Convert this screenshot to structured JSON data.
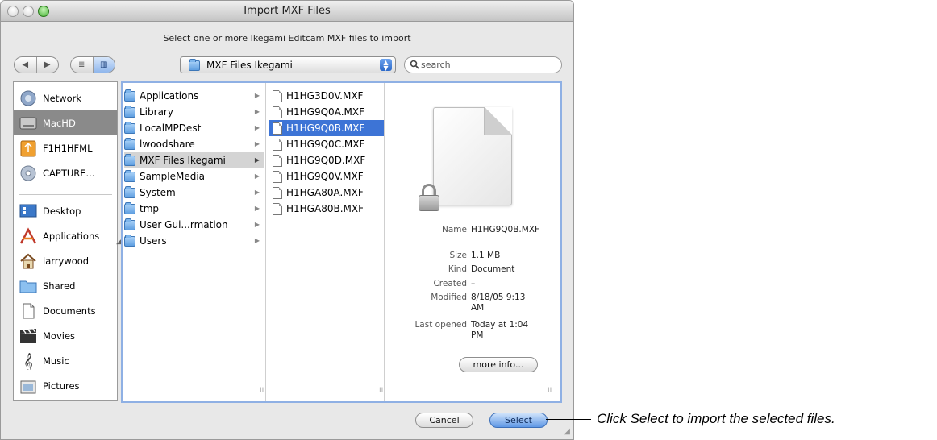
{
  "window": {
    "title": "Import MXF Files",
    "subtitle": "Select one or more Ikegami Editcam MXF files to import"
  },
  "toolbar": {
    "back_icon": "◀",
    "forward_icon": "▶",
    "list_view_icon": "≣",
    "column_view_icon": "▥",
    "location": "MXF Files Ikegami",
    "search_placeholder": "search"
  },
  "sidebar": {
    "items": [
      {
        "label": "Network",
        "icon": "network-icon"
      },
      {
        "label": "MacHD",
        "icon": "hard-disk-icon",
        "selected": true
      },
      {
        "label": "F1H1HFML",
        "icon": "removable-disk-icon"
      },
      {
        "label": "CAPTURE...",
        "icon": "disc-icon"
      },
      {
        "label": "Desktop",
        "icon": "desktop-icon"
      },
      {
        "label": "Applications",
        "icon": "applications-icon"
      },
      {
        "label": "larrywood",
        "icon": "home-icon"
      },
      {
        "label": "Shared",
        "icon": "folder-icon"
      },
      {
        "label": "Documents",
        "icon": "documents-icon"
      },
      {
        "label": "Movies",
        "icon": "movies-icon"
      },
      {
        "label": "Music",
        "icon": "music-icon"
      },
      {
        "label": "Pictures",
        "icon": "pictures-icon"
      }
    ]
  },
  "columns": {
    "col1": [
      {
        "label": "Applications",
        "icon": "applications-folder-icon"
      },
      {
        "label": "Library",
        "icon": "library-folder-icon"
      },
      {
        "label": "LocalMPDest",
        "icon": "folder-icon"
      },
      {
        "label": "lwoodshare",
        "icon": "folder-icon"
      },
      {
        "label": "MXF Files Ikegami",
        "icon": "folder-icon",
        "active": true
      },
      {
        "label": "SampleMedia",
        "icon": "folder-icon"
      },
      {
        "label": "System",
        "icon": "folder-icon"
      },
      {
        "label": "tmp",
        "icon": "folder-icon"
      },
      {
        "label": "User Gui...rmation",
        "icon": "folder-icon"
      },
      {
        "label": "Users",
        "icon": "users-folder-icon"
      }
    ],
    "col2": [
      {
        "label": "H1HG3D0V.MXF"
      },
      {
        "label": "H1HG9Q0A.MXF"
      },
      {
        "label": "H1HG9Q0B.MXF",
        "selected": true
      },
      {
        "label": "H1HG9Q0C.MXF"
      },
      {
        "label": "H1HG9Q0D.MXF"
      },
      {
        "label": "H1HG9Q0V.MXF"
      },
      {
        "label": "H1HGA80A.MXF"
      },
      {
        "label": "H1HGA80B.MXF"
      }
    ],
    "scroll_marker": "II"
  },
  "preview": {
    "info": [
      {
        "label": "Name",
        "value": "H1HG9Q0B.MXF"
      },
      {
        "label": "Size",
        "value": "1.1 MB"
      },
      {
        "label": "Kind",
        "value": "Document"
      },
      {
        "label": "Created",
        "value": "–"
      },
      {
        "label": "Modified",
        "value": "8/18/05 9:13 AM"
      },
      {
        "label": "Last opened",
        "value": "Today at 1:04 PM"
      }
    ],
    "more_info_label": "more info..."
  },
  "buttons": {
    "cancel": "Cancel",
    "select": "Select"
  },
  "callout": "Click Select to import the selected files."
}
